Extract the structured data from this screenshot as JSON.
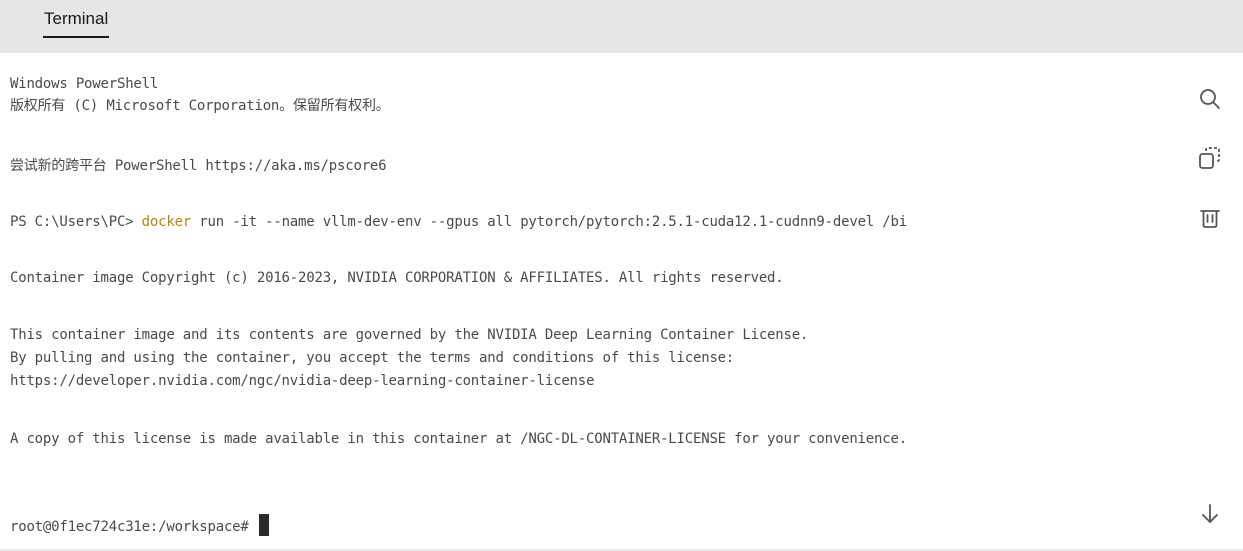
{
  "tabs": [
    {
      "label": "Terminal",
      "active": true
    }
  ],
  "terminal": {
    "header_line1": "Windows PowerShell",
    "header_line2": "版权所有 (C) Microsoft Corporation。保留所有权利。",
    "header_line3": "尝试新的跨平台 PowerShell https://aka.ms/pscore6",
    "prompt_prefix": "PS C:\\Users\\PC> ",
    "prompt_command": "docker",
    "prompt_args": " run -it --name vllm-dev-env --gpus all pytorch/pytorch:2.5.1-cuda12.1-cudnn9-devel /bi",
    "copyright_line": "Container image Copyright (c) 2016-2023, NVIDIA CORPORATION & AFFILIATES. All rights reserved.",
    "license_line1": "This container image and its contents are governed by the NVIDIA Deep Learning Container License.",
    "license_line2": "By pulling and using the container, you accept the terms and conditions of this license:",
    "license_line3": "https://developer.nvidia.com/ngc/nvidia-deep-learning-container-license",
    "license_line4": "A copy of this license is made available in this container at /NGC-DL-CONTAINER-LICENSE for your convenience.",
    "shell_prompt": "root@0f1ec724c31e:/workspace# "
  },
  "icons": {
    "search": "search-icon",
    "copy": "copy-icon",
    "trash": "trash-icon",
    "scroll_down": "arrow-down-icon"
  },
  "colors": {
    "tabbar_bg": "#e6e6e6",
    "text": "#4a4a4a",
    "command": "#b8860b"
  }
}
